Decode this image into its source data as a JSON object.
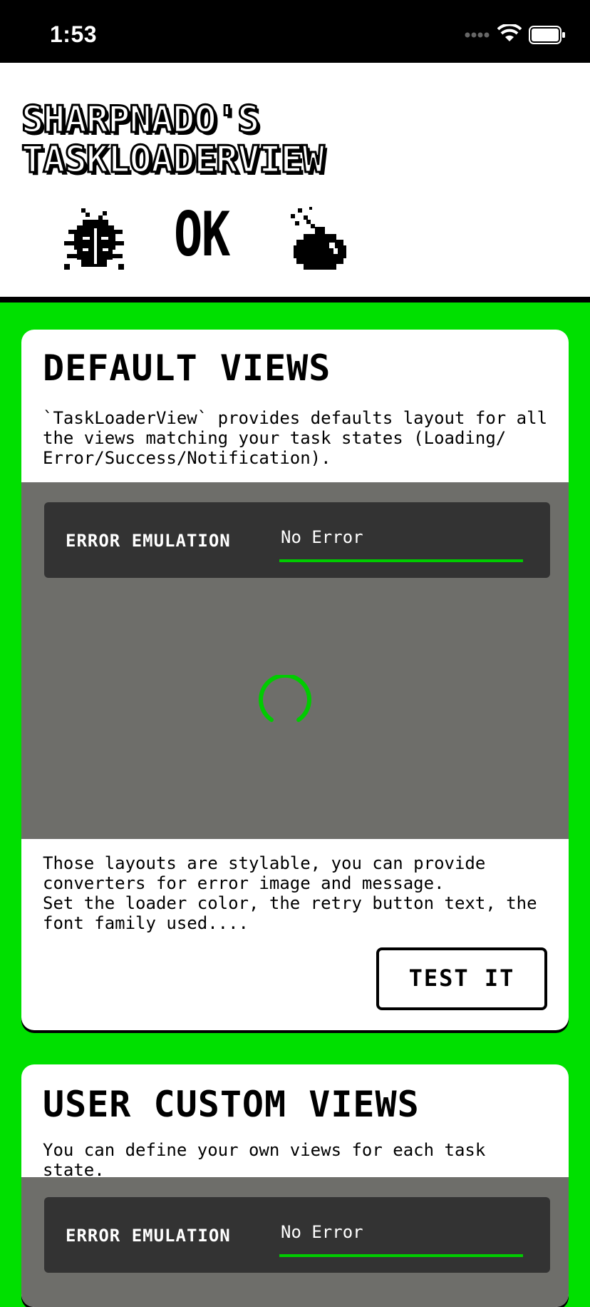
{
  "status_bar": {
    "time": "1:53"
  },
  "header": {
    "title_line1": "SHARPNADO'S",
    "title_line2": "TASKLOADERVIEW",
    "icons": [
      "bug-icon",
      "ok-text",
      "bomb-icon"
    ],
    "ok_label": "OK"
  },
  "default_views": {
    "heading": "DEFAULT VIEWS",
    "description": "`TaskLoaderView` provides defaults layout for all the views matching your task states (Loading/ Error/Success/Notification).",
    "error_emulation_label": "ERROR EMULATION",
    "error_emulation_value": "No Error",
    "styling_text": "Those layouts are stylable, you can provide converters for error image and message.\nSet the loader color, the retry button text, the font family used....",
    "test_button": "TEST IT"
  },
  "user_custom_views": {
    "heading": "USER CUSTOM VIEWS",
    "description": "You can define your own views for each task state.",
    "error_emulation_label": "ERROR EMULATION",
    "error_emulation_value": "No Error"
  },
  "colors": {
    "accent": "#00e000",
    "demo_background": "#6e6e6a",
    "panel": "#333333"
  }
}
